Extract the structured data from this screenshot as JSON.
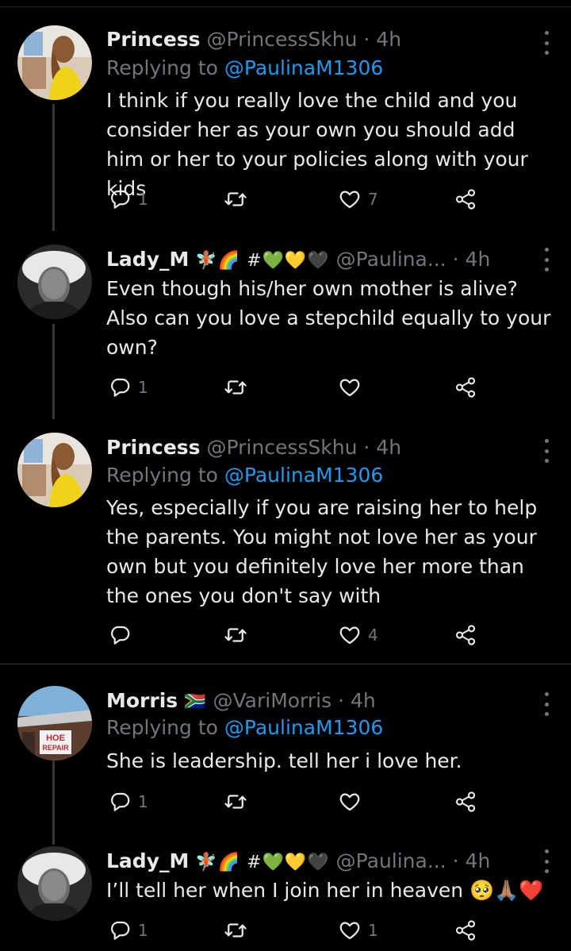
{
  "tweets": [
    {
      "name": "Princess",
      "badges": "",
      "handle": "@PrincessSkhu",
      "sep": "·",
      "time": "4h",
      "replying_prefix": "Replying to",
      "replying_to": "@PaulinaM1306",
      "text": "I think if you really love the child and you consider her as your own you should add him or her to your policies along with your kids",
      "reply_count": "1",
      "retweet_count": "",
      "like_count": "7"
    },
    {
      "name": "Lady_M",
      "badges": "🧚🏽🌈 #💚💛🖤",
      "handle": "@Paulina...",
      "sep": "·",
      "time": "4h",
      "text": "Even though his/her own mother is alive? Also can you love a stepchild equally to your own?",
      "reply_count": "1",
      "retweet_count": "",
      "like_count": ""
    },
    {
      "name": "Princess",
      "badges": "",
      "handle": "@PrincessSkhu",
      "sep": "·",
      "time": "4h",
      "replying_prefix": "Replying to",
      "replying_to": "@PaulinaM1306",
      "text": "Yes, especially if you are raising her to help the parents.  You might not love her as your own but you definitely love her more than the ones you don't say with",
      "reply_count": "",
      "retweet_count": "",
      "like_count": "4"
    },
    {
      "name": "Morris",
      "badges": "🇿🇦",
      "handle": "@VariMorris",
      "sep": "·",
      "time": "4h",
      "replying_prefix": "Replying to",
      "replying_to": "@PaulinaM1306",
      "text": "She is leadership. tell her i love her.",
      "avatar_sign_line1": "HOE",
      "avatar_sign_line2": "REPAIR",
      "reply_count": "1",
      "retweet_count": "",
      "like_count": ""
    },
    {
      "name": "Lady_M",
      "badges": "🧚🏽🌈 #💚💛🖤",
      "handle": "@Paulina...",
      "sep": "·",
      "time": "4h",
      "text": "I’ll tell her when I join her in heaven 🥺🙏🏽❤️",
      "reply_count": "1",
      "retweet_count": "",
      "like_count": "1"
    }
  ],
  "colors": {
    "background": "#000000",
    "text": "#e7e9ea",
    "secondary": "#71767b",
    "link": "#1d9bf0",
    "divider": "#2f3336"
  },
  "icons": {
    "reply": "reply-icon",
    "retweet": "retweet-icon",
    "like": "heart-icon",
    "share": "share-icon",
    "more": "more-icon"
  }
}
